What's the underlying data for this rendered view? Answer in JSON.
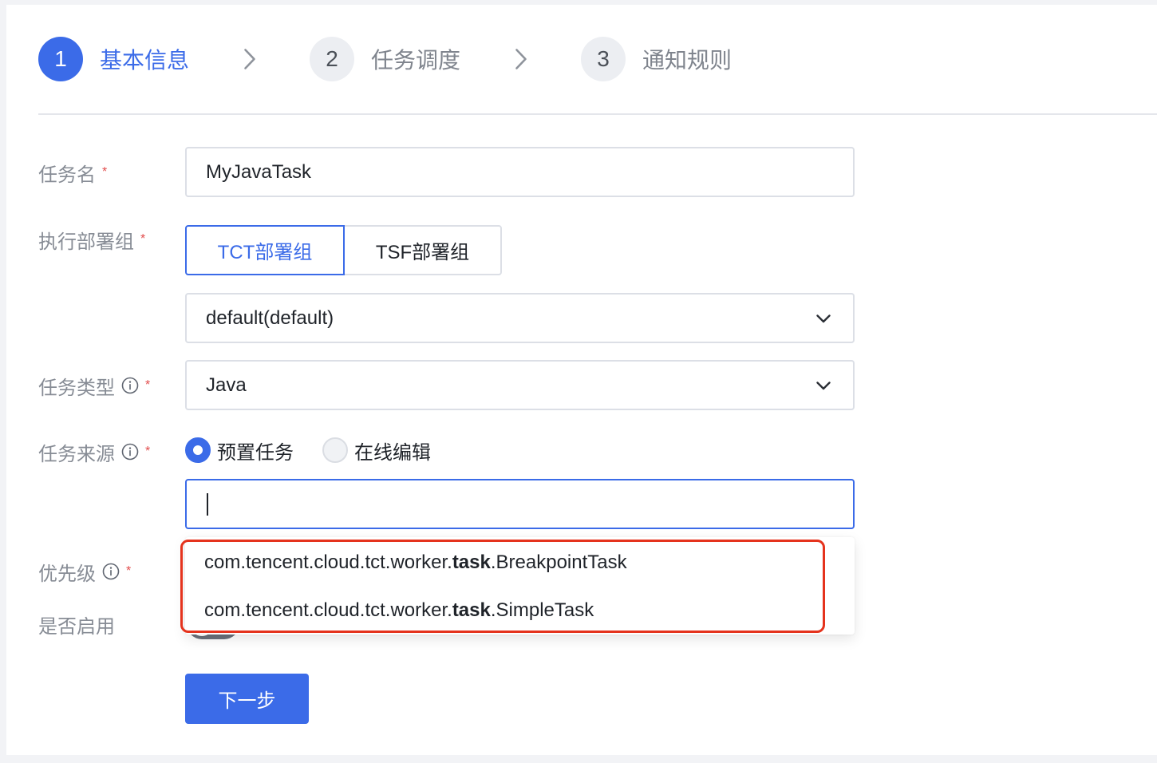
{
  "colors": {
    "accent": "#3b6be8",
    "required": "#e24d4d",
    "highlight": "#e5331d",
    "label": "#878c95",
    "text": "#1f2329"
  },
  "stepper": {
    "steps": [
      {
        "number": "1",
        "label": "基本信息",
        "active": true
      },
      {
        "number": "2",
        "label": "任务调度",
        "active": false
      },
      {
        "number": "3",
        "label": "通知规则",
        "active": false
      }
    ],
    "separator_icon": "chevron-right-icon"
  },
  "form": {
    "task_name": {
      "label": "任务名",
      "required_mark": "*",
      "value": "MyJavaTask"
    },
    "deploy_group": {
      "label": "执行部署组",
      "required_mark": "*",
      "options": [
        {
          "label": "TCT部署组",
          "selected": true
        },
        {
          "label": "TSF部署组",
          "selected": false
        }
      ],
      "group_value": "default(default)",
      "dropdown_icon": "chevron-down-icon"
    },
    "task_type": {
      "label": "任务类型",
      "info_icon": "info-circle-icon",
      "required_mark": "*",
      "value": "Java",
      "dropdown_icon": "chevron-down-icon"
    },
    "task_source": {
      "label": "任务来源",
      "info_icon": "info-circle-icon",
      "required_mark": "*",
      "radios": [
        {
          "label": "预置任务",
          "checked": true
        },
        {
          "label": "在线编辑",
          "checked": false
        }
      ],
      "suggestions": [
        {
          "prefix": "com.tencent.cloud.tct.worker.",
          "match": "task",
          "suffix": ".BreakpointTask"
        },
        {
          "prefix": "com.tencent.cloud.tct.worker.",
          "match": "task",
          "suffix": ".SimpleTask"
        }
      ]
    },
    "priority": {
      "label": "优先级",
      "info_icon": "info-circle-icon",
      "required_mark": "*"
    },
    "enabled": {
      "label": "是否启用",
      "checked": false
    }
  },
  "actions": {
    "next_label": "下一步"
  }
}
